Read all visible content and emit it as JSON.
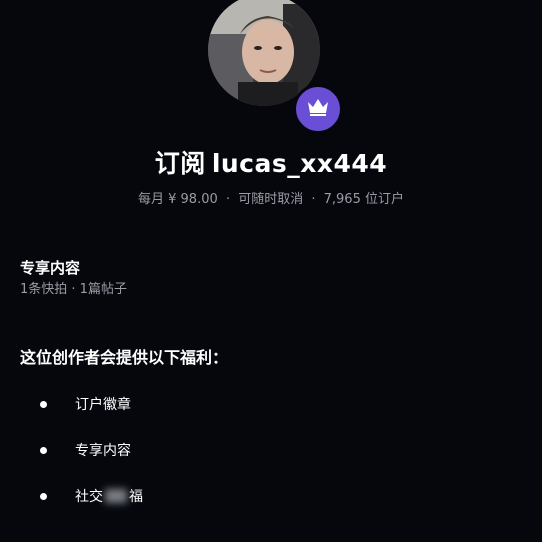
{
  "header": {
    "title_prefix": "订阅",
    "username": "lucas_xx444",
    "price_label": "每月 ¥ 98.00",
    "cancel_label": "可随时取消",
    "subscribers_label": "7,965 位订户",
    "separator": "·"
  },
  "exclusive": {
    "title": "专享内容",
    "counts": "1条快拍 · 1篇帖子"
  },
  "benefits": {
    "title": "这位创作者会提供以下福利：",
    "items": [
      {
        "label": "订户徽章"
      },
      {
        "label": "专享内容"
      },
      {
        "label_start": "社交",
        "label_end": "福"
      }
    ]
  },
  "icons": {
    "crown": "crown-icon",
    "bullet": "bullet-icon"
  },
  "colors": {
    "background": "#05070d",
    "badge": "#6a4fd6",
    "secondary_text": "#9a9ca6"
  }
}
